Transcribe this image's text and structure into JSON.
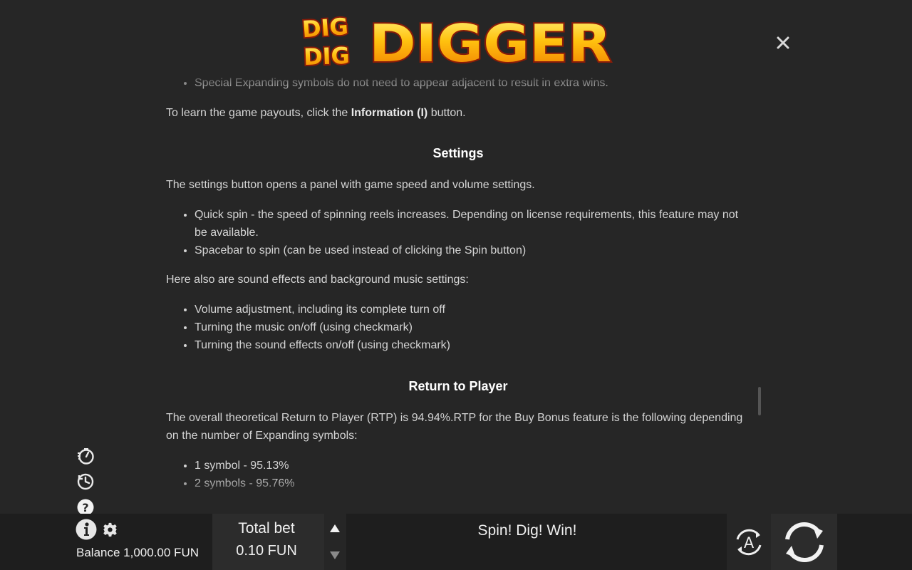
{
  "logo": {
    "line1a": "DIG",
    "line1b": "DIG",
    "main": "DIGGER"
  },
  "content": {
    "bullet_expanding": "Special Expanding symbols do not need to appear adjacent to result in extra wins.",
    "payouts_prefix": "To learn the game payouts, click the ",
    "payouts_bold": "Information (I)",
    "payouts_suffix": " button.",
    "settings_heading": "Settings",
    "settings_intro": "The settings button opens a panel with game speed and volume settings.",
    "settings_items": [
      "Quick spin - the speed of spinning reels increases. Depending on license requirements, this feature may not be available.",
      "Spacebar to spin (can be used instead of clicking the Spin button)"
    ],
    "sound_intro": "Here also are sound effects and background music settings:",
    "sound_items": [
      "Volume adjustment, including its complete turn off",
      "Turning the music on/off (using checkmark)",
      "Turning the sound effects on/off (using checkmark)"
    ],
    "rtp_heading": "Return to Player",
    "rtp_text": "The overall theoretical Return to Player (RTP) is 94.94%.RTP for the Buy Bonus feature is the following depending on the number of Expanding symbols:",
    "rtp_items": [
      "1 symbol - 95.13%",
      "2 symbols - 95.76%"
    ]
  },
  "bottom": {
    "balance_label": "Balance 1,000.00 FUN",
    "bet_label": "Total bet",
    "bet_value": "0.10 FUN",
    "message": "Spin! Dig! Win!",
    "auto_label": "A"
  },
  "icons": {
    "close": "close-icon",
    "turbo": "turbo-speed-icon",
    "history": "history-icon",
    "help": "help-icon",
    "info": "info-icon",
    "gear": "gear-icon",
    "autoplay": "autoplay-icon",
    "spin": "spin-icon"
  },
  "colors": {
    "background": "#262626",
    "text": "#d4d4d4",
    "heading": "#ffffff",
    "logo_yellow": "#ffd21a",
    "logo_orange": "#f08a00",
    "logo_red": "#b32410"
  }
}
